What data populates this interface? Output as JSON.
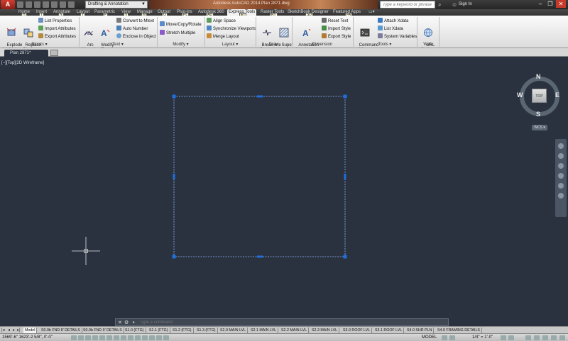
{
  "titlebar": {
    "app_letter": "A",
    "workspace": "Drafting & Annotation",
    "title": "Autodesk AutoCAD 2014    Plan 2871.dwg",
    "search_placeholder": "Type a keyword or phrase",
    "sign_in": "Sign In",
    "controls": [
      "–",
      "❐",
      "✕"
    ]
  },
  "ribbon_tabs": [
    "Home",
    "Insert",
    "Annotate",
    "Layout",
    "Parametric",
    "View",
    "Manage",
    "Output",
    "Plug-ins",
    "Autodesk 360",
    "Express Tools",
    "Raster Tools",
    "SketchBook Designer",
    "Featured Apps"
  ],
  "active_tab": "Express Tools",
  "keytips": [
    "H",
    "I",
    "N",
    "Y",
    "P",
    "V",
    "M",
    "O",
    "PL",
    "AD",
    "ET",
    "RT",
    "SD",
    "FA"
  ],
  "panels": {
    "blocks": {
      "title": "Blocks",
      "explode": "Explode\nAttributes",
      "replace": "Replace\nBlock",
      "list_properties": "List Properties",
      "import_attributes": "Import Attributes",
      "export_attributes": "Export Attributes"
    },
    "text": {
      "title": "Text",
      "arc_aligned": "Arc\nAligned",
      "modify_text": "Modify\nText",
      "convert_mtext": "Convert to Mtext",
      "auto_number": "Auto Number",
      "enclose": "Enclose in Object"
    },
    "modify": {
      "title": "Modify",
      "move_copy_rotate": "Move/Copy/Rotate",
      "stretch_multiple": "Stretch Multiple"
    },
    "layout": {
      "title": "Layout",
      "align_space": "Align Space",
      "sync_viewports": "Synchronize Viewports",
      "merge_layout": "Merge Layout"
    },
    "draw": {
      "title": "Draw",
      "breakline": "Break-line\nSymbol",
      "super_hatch": "Super\nHatch"
    },
    "dimension": {
      "title": "Dimension",
      "annotation_attachment": "Annotation\nAttachment",
      "reset_text": "Reset Text",
      "import_style": "Import Style",
      "export_style": "Export Style"
    },
    "tools": {
      "title": "Tools",
      "command_aliases": "Command\nAliases",
      "attach_xdata": "Attach Xdata",
      "list_xdata": "List Xdata",
      "system_variables": "System Variables"
    },
    "web": {
      "title": "Web",
      "url_options": "URL\nOptions"
    }
  },
  "document_tab": "Plan 2871*",
  "viewport_label": "[−][Top][2D Wireframe]",
  "viewcube": {
    "face": "TOP",
    "north": "N",
    "south": "S",
    "east": "E",
    "west": "W",
    "wcs": "WCS"
  },
  "command_line": {
    "placeholder": "Type a command",
    "close": "✕",
    "prompt": "▸"
  },
  "layout_tabs": [
    "Model",
    "S0.0b FND 8' DETAILS",
    "S0.0b FND 9' DETAILS",
    "S1.0 (FTG)",
    "S1.1 (FTG)",
    "S1.2 (FTG)",
    "S1.3 (FTG)",
    "S2.0 MAIN LVL",
    "S2.1 MAIN LVL",
    "S2.2 MAIN LVL",
    "S2.3 MAIN LVL",
    "S3.0 ROOF LVL",
    "S3.1 ROOF LVL",
    "S4.0 SHR PLN",
    "S4.0 FRAMING DETAILS"
  ],
  "active_layout": "Model",
  "status": {
    "coords": "1569'-6\"    1623'-2 5/8\", 0'-0\"",
    "model": "MODEL",
    "scale": "1/4\" = 1'-0\""
  },
  "colors": {
    "canvas": "#2a323f",
    "grip": "#1d6fe0",
    "selection": "#8fb3ff"
  }
}
